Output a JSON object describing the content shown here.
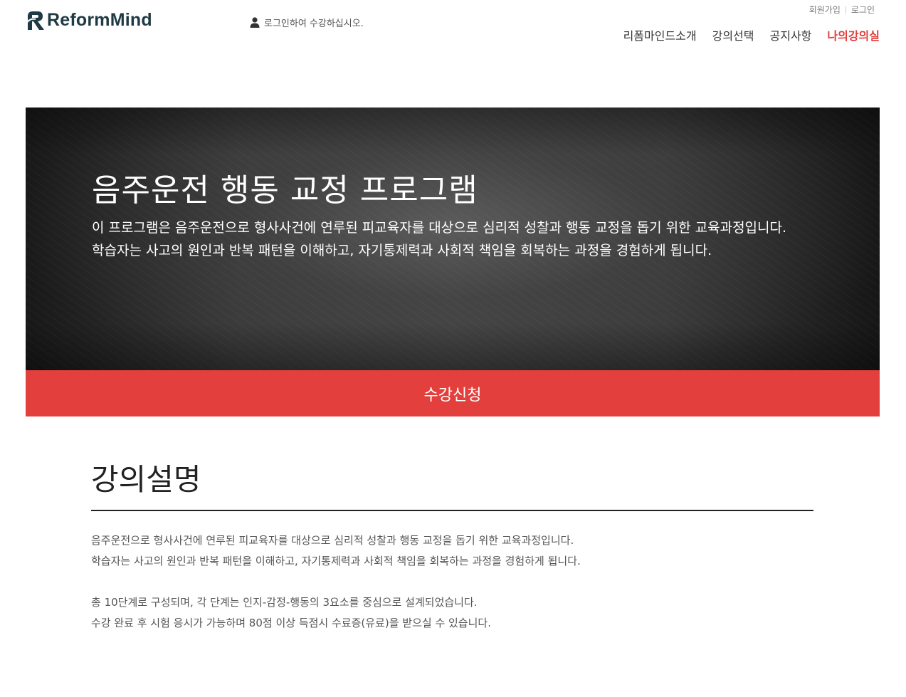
{
  "header": {
    "logo_text": "ReformMind",
    "login_message": "로그인하여 수강하십시오.",
    "util_links": [
      "회원가입",
      "로그인"
    ],
    "nav": [
      {
        "label": "리폼마인드소개",
        "active": false
      },
      {
        "label": "강의선택",
        "active": false
      },
      {
        "label": "공지사항",
        "active": false
      },
      {
        "label": "나의강의실",
        "active": true
      }
    ]
  },
  "hero": {
    "title": "음주운전 행동 교정 프로그램",
    "description": "이 프로그램은 음주운전으로 형사사건에 연루된 피교육자를 대상으로 심리적 성찰과 행동 교정을 돕기 위한 교육과정입니다. 학습자는 사고의 원인과 반복 패턴을 이해하고, 자기통제력과 사회적 책임을 회복하는 과정을 경험하게 됩니다."
  },
  "apply_button": "수강신청",
  "course_description": {
    "title": "강의설명",
    "paragraphs": [
      [
        "음주운전으로 형사사건에 연루된 피교육자를 대상으로 심리적 성찰과 행동 교정을 돕기 위한 교육과정입니다.",
        "학습자는 사고의 원인과 반복 패턴을 이해하고, 자기통제력과 사회적 책임을 회복하는 과정을 경험하게 됩니다."
      ],
      [
        "총 10단계로 구성되며, 각 단계는 인지-감정-행동의 3요소를 중심으로 설계되었습니다.",
        "수강 완료 후 시험 응시가 가능하며 80점 이상 득점시 수료증(유료)을 받으실 수 있습니다."
      ]
    ]
  },
  "colors": {
    "accent": "#e33f3d",
    "logo": "#1f3a44",
    "hero_bg": "#3a3a3a"
  },
  "icons": {
    "logo_mark": "logo-icon",
    "user": "user-icon"
  }
}
